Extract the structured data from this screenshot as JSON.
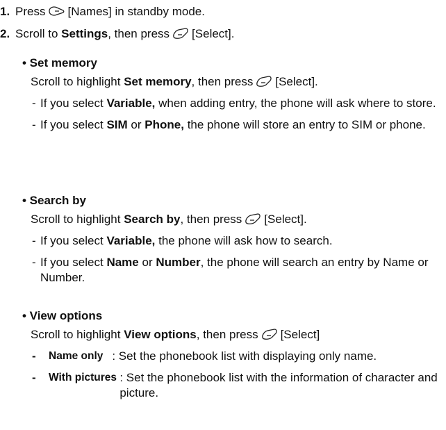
{
  "steps": [
    {
      "num": "1.",
      "pre": "Press",
      "icon": "left-soft-key-icon",
      "post": "[Names] in standby mode."
    },
    {
      "num": "2.",
      "pre": "Scroll to",
      "bold": "Settings",
      "mid": ", then press",
      "icon": "right-soft-key-icon",
      "post": "[Select]."
    }
  ],
  "sections": {
    "set_memory": {
      "title": "• Set memory",
      "intro_pre": "Scroll to highlight",
      "intro_bold": "Set memory",
      "intro_mid": ", then press",
      "intro_post": "[Select].",
      "bullets": [
        {
          "dash": "-",
          "pre": "If you select",
          "b1": "Variable,",
          "post": "when adding entry, the phone will ask where to store."
        },
        {
          "dash": "-",
          "pre": "If you select",
          "b1": "SIM",
          "mid": "or",
          "b2": "Phone,",
          "post": "the phone will store an entry to SIM or phone."
        }
      ]
    },
    "search_by": {
      "title": "• Search by",
      "intro_pre": "Scroll to highlight",
      "intro_bold": "Search by",
      "intro_mid": ", then press",
      "intro_post": "[Select].",
      "bullets": [
        {
          "dash": "-",
          "pre": "If you select",
          "b1": "Variable,",
          "post": "the phone will ask how to search."
        },
        {
          "dash": "-",
          "pre": "If you select",
          "b1": "Name",
          "mid": "or",
          "b2": "Number",
          "post": ", the phone will search an entry by Name or Number."
        }
      ]
    },
    "view_options": {
      "title": "• View options",
      "intro_pre": "Scroll to highlight",
      "intro_bold": "View options",
      "intro_mid": ", then press",
      "intro_post": "[Select]",
      "options": [
        {
          "dash": "-",
          "name": "Name only   ",
          "desc": ": Set the phonebook list with displaying only name."
        },
        {
          "dash": "-",
          "name": "With pictures ",
          "desc": ": Set the phonebook list with the information of character and picture."
        }
      ]
    }
  }
}
